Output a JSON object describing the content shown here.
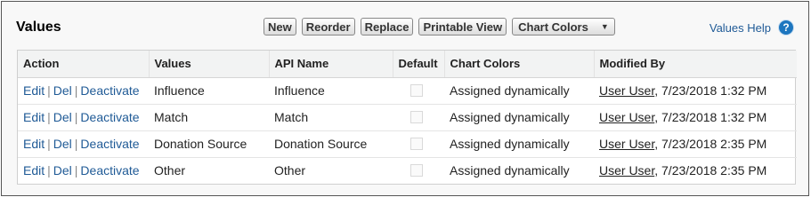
{
  "panel": {
    "title": "Values"
  },
  "toolbar": {
    "new_label": "New",
    "reorder_label": "Reorder",
    "replace_label": "Replace",
    "printable_label": "Printable View",
    "chart_colors_label": "Chart Colors"
  },
  "help": {
    "label": "Values Help",
    "icon": "?"
  },
  "table": {
    "headers": [
      "Action",
      "Values",
      "API Name",
      "Default",
      "Chart Colors",
      "Modified By"
    ],
    "rows": [
      {
        "edit": "Edit",
        "del": "Del",
        "deactivate": "Deactivate",
        "value": "Influence",
        "api_name": "Influence",
        "default": false,
        "chart_colors": "Assigned dynamically",
        "user": "User User",
        "modified": ", 7/23/2018 1:32 PM"
      },
      {
        "edit": "Edit",
        "del": "Del",
        "deactivate": "Deactivate",
        "value": "Match",
        "api_name": "Match",
        "default": false,
        "chart_colors": "Assigned dynamically",
        "user": "User User",
        "modified": ", 7/23/2018 1:32 PM"
      },
      {
        "edit": "Edit",
        "del": "Del",
        "deactivate": "Deactivate",
        "value": "Donation Source",
        "api_name": "Donation Source",
        "default": false,
        "chart_colors": "Assigned dynamically",
        "user": "User User",
        "modified": ", 7/23/2018 2:35 PM"
      },
      {
        "edit": "Edit",
        "del": "Del",
        "deactivate": "Deactivate",
        "value": "Other",
        "api_name": "Other",
        "default": false,
        "chart_colors": "Assigned dynamically",
        "user": "User User",
        "modified": ", 7/23/2018 2:35 PM"
      }
    ]
  }
}
